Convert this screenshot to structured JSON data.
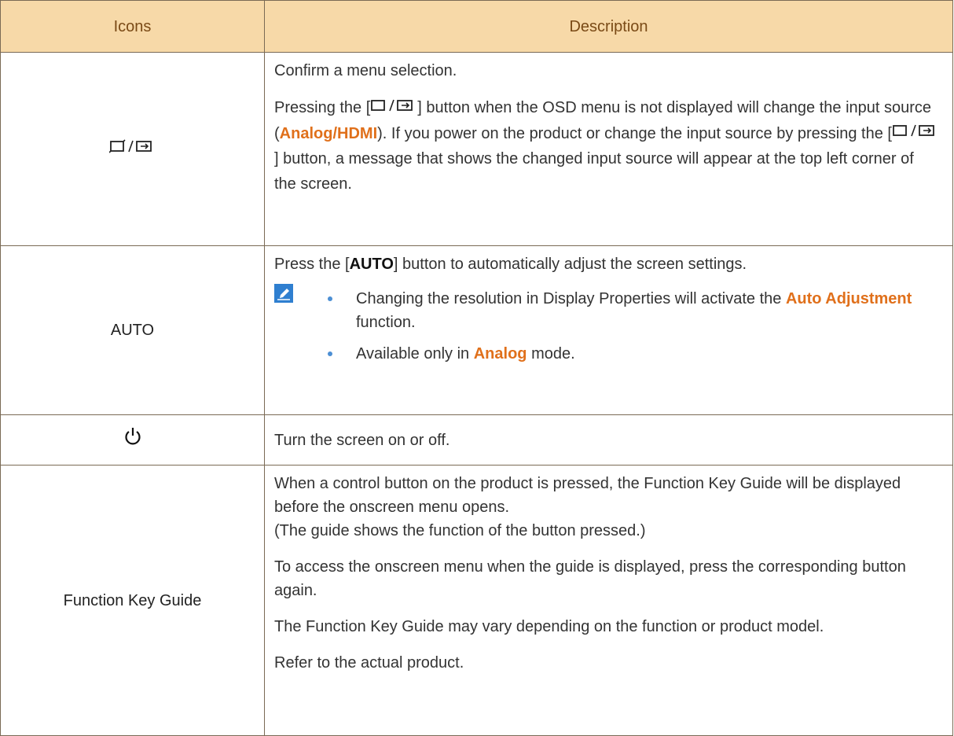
{
  "table": {
    "headers": [
      "Icons",
      "Description"
    ],
    "rows": {
      "source": {
        "icon_name": "source-enter-icon",
        "p1": "Confirm a menu selection.",
        "p2_a": "Pressing the [",
        "p2_b": "] button when the OSD menu is not displayed will change the input source (",
        "p2_analog": "Analog",
        "p2_slash": "/",
        "p2_hdmi": "HDMI",
        "p2_c": "). If you power on the product or change the input source by pressing the [",
        "p2_d": "] button, a message that shows the changed input source will appear at the top left corner of the screen."
      },
      "auto": {
        "icon_label": "AUTO",
        "p1_a": "Press the [",
        "p1_btn": "AUTO",
        "p1_b": "] button to automatically adjust the screen settings.",
        "note_icon": "note-pencil-icon",
        "notes": {
          "n1_a": "Changing the resolution in Display Properties will activate the ",
          "n1_hl": "Auto Adjustment",
          "n1_b": " function.",
          "n2_a": "Available only in ",
          "n2_hl": "Analog",
          "n2_b": " mode."
        }
      },
      "power": {
        "icon_name": "power-icon",
        "p1": "Turn the screen on or off."
      },
      "guide": {
        "icon_label": "Function Key Guide",
        "p1_line1": "When a control button on the product is pressed, the Function Key Guide will be displayed before the onscreen menu opens.",
        "p1_line2": "(The guide shows the function of the button pressed.)",
        "p2": "To access the onscreen menu when the guide is displayed, press the corresponding button again.",
        "p3": "The Function Key Guide may vary depending on the function or product model.",
        "p4": "Refer to the actual product."
      }
    }
  },
  "colors": {
    "header_bg": "#f7d9a8",
    "header_text": "#7a4a16",
    "highlight": "#e0701b",
    "border": "#7a6a55"
  }
}
